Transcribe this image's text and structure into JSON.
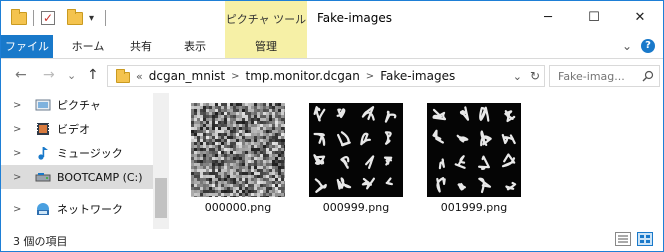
{
  "window": {
    "title": "Fake-images",
    "context_tab_group": "ピクチャ ツール",
    "controls": {
      "minimize": "─",
      "maximize": "☐",
      "close": "✕"
    }
  },
  "quick_access": {
    "dropdown_glyph": "▾"
  },
  "ribbon": {
    "tabs": [
      {
        "label": "ファイル"
      },
      {
        "label": "ホーム"
      },
      {
        "label": "共有"
      },
      {
        "label": "表示"
      },
      {
        "label": "管理"
      }
    ],
    "collapse_glyph": "⌄",
    "help_glyph": "?"
  },
  "navigation": {
    "back_glyph": "←",
    "forward_glyph": "→",
    "recent_glyph": "⌄",
    "up_glyph": "↑",
    "overflow_glyph": "«",
    "breadcrumb": [
      "dcgan_mnist",
      "tmp.monitor.dcgan",
      "Fake-images"
    ],
    "refresh_glyph": "↻",
    "dropdown_glyph": "⌄",
    "search_placeholder": "Fake-imag..."
  },
  "nav_pane": {
    "items": [
      {
        "label": "ピクチャ",
        "icon": "pictures-icon",
        "selected": false
      },
      {
        "label": "ビデオ",
        "icon": "videos-icon",
        "selected": false
      },
      {
        "label": "ミュージック",
        "icon": "music-icon",
        "selected": false
      },
      {
        "label": "BOOTCAMP (C:)",
        "icon": "drive-icon",
        "selected": true
      },
      {
        "label": "ネットワーク",
        "icon": "network-icon",
        "selected": false
      }
    ]
  },
  "files": [
    {
      "name": "000000.png",
      "kind": "noise"
    },
    {
      "name": "000999.png",
      "kind": "digits"
    },
    {
      "name": "001999.png",
      "kind": "digits"
    }
  ],
  "status": {
    "item_count": "3 個の項目"
  },
  "colors": {
    "accent": "#1979ca",
    "context_tab": "#f6f0a6",
    "folder": "#f4c34e"
  }
}
